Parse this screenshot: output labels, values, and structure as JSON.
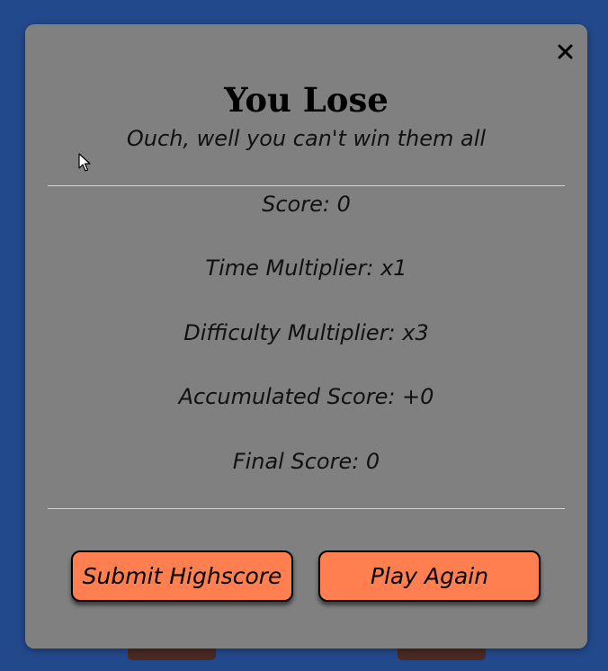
{
  "modal": {
    "close_icon": "close-icon",
    "title": "You Lose",
    "subtitle": "Ouch, well you can't win them all"
  },
  "stats": {
    "score": "Score: 0",
    "time_multiplier": "Time Multiplier: x1",
    "difficulty_multiplier": "Difficulty Multiplier: x3",
    "accumulated_score": "Accumulated Score: +0",
    "final_score": "Final Score: 0"
  },
  "actions": {
    "submit_label": "Submit Highscore",
    "play_again_label": "Play Again"
  },
  "colors": {
    "background": "#22498c",
    "modal": "#808080",
    "button": "#ff7f50"
  }
}
